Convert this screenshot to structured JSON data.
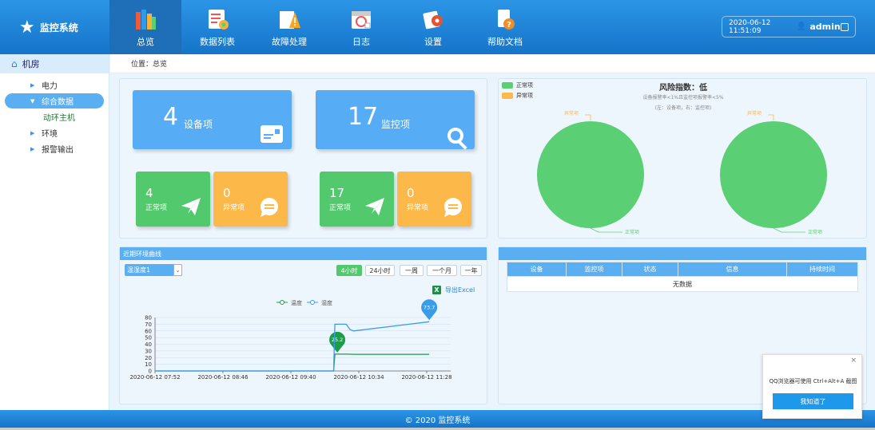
{
  "app": {
    "title": "监控系统"
  },
  "nav": [
    {
      "label": "总览",
      "icon": "books-icon",
      "active": true
    },
    {
      "label": "数据列表",
      "icon": "data-list-icon"
    },
    {
      "label": "故障处理",
      "icon": "warning-icon"
    },
    {
      "label": "日志",
      "icon": "calendar-log-icon"
    },
    {
      "label": "设置",
      "icon": "settings-icon"
    },
    {
      "label": "帮助文档",
      "icon": "help-doc-icon"
    }
  ],
  "header": {
    "datetime": "2020-06-12  11:51:09",
    "user": "admin"
  },
  "sidebar": {
    "root": "机房",
    "items": [
      {
        "label": "电力",
        "arrow": "▶"
      },
      {
        "label": "综合数据",
        "arrow": "▼",
        "active": true
      },
      {
        "label": "动环主机",
        "sub": true
      },
      {
        "label": "环境",
        "arrow": "▶"
      },
      {
        "label": "报警输出",
        "arrow": "▶"
      }
    ]
  },
  "breadcrumb": "位置：总览",
  "stats": {
    "devices": {
      "count": "4",
      "label": "设备项",
      "normal": "4",
      "normal_label": "正常项",
      "abnormal": "0",
      "abnormal_label": "异常项"
    },
    "monitors": {
      "count": "17",
      "label": "监控项",
      "normal": "17",
      "normal_label": "正常项",
      "abnormal": "0",
      "abnormal_label": "异常项"
    }
  },
  "risk": {
    "title": "风险指数：低",
    "desc": "设备报警率<1%且监控项报警率<5%",
    "note": "(左：设备项，右：监控项)",
    "legend": [
      {
        "label": "正常项",
        "color": "#5bcf73"
      },
      {
        "label": "异常项",
        "color": "#fcb94a"
      }
    ],
    "pie_labels": {
      "abnormal": "异常项",
      "normal": "正常项"
    },
    "pies": [
      {
        "normal": 4,
        "abnormal": 0
      },
      {
        "normal": 17,
        "abnormal": 0
      }
    ]
  },
  "curve": {
    "title": "近期环境曲线",
    "select_value": "温湿度1",
    "ranges": [
      "4小时",
      "24小时",
      "一周",
      "一个月",
      "一年"
    ],
    "active_range": 0,
    "export_label": "导出Excel"
  },
  "chart_data": {
    "type": "line",
    "legend": [
      "温度",
      "湿度"
    ],
    "x_ticks": [
      "2020-06-12 07:52",
      "2020-06-12 08:46",
      "2020-06-12 09:40",
      "2020-06-12 10:34",
      "2020-06-12 11:28"
    ],
    "ylim": [
      0,
      80
    ],
    "y_ticks": [
      0,
      10,
      20,
      30,
      40,
      50,
      60,
      70,
      80
    ],
    "series": [
      {
        "name": "温度",
        "color": "#1e9c4a",
        "x": [
          "2020-06-12 07:52",
          "2020-06-12 10:14",
          "2020-06-12 10:15",
          "2020-06-12 10:25",
          "2020-06-12 10:30",
          "2020-06-12 11:30"
        ],
        "y": [
          0,
          0,
          25.2,
          25.2,
          25,
          25
        ],
        "max_label": "25.2"
      },
      {
        "name": "湿度",
        "color": "#3a9be8",
        "x": [
          "2020-06-12 07:52",
          "2020-06-12 10:14",
          "2020-06-12 10:15",
          "2020-06-12 10:24",
          "2020-06-12 10:27",
          "2020-06-12 10:30",
          "2020-06-12 11:30"
        ],
        "y": [
          0,
          0,
          70,
          70,
          62,
          60,
          73.7
        ],
        "max_label": "73.7"
      }
    ],
    "grid": true
  },
  "alarm_table": {
    "columns": [
      "设备",
      "监控项",
      "状态",
      "信息",
      "持续时间"
    ],
    "empty": "无数据"
  },
  "footer": "© 2020  监控系统",
  "toast": {
    "message": "QQ浏览器可使用 Ctrl+Alt+A 截图",
    "button": "我知道了",
    "close": "×"
  }
}
